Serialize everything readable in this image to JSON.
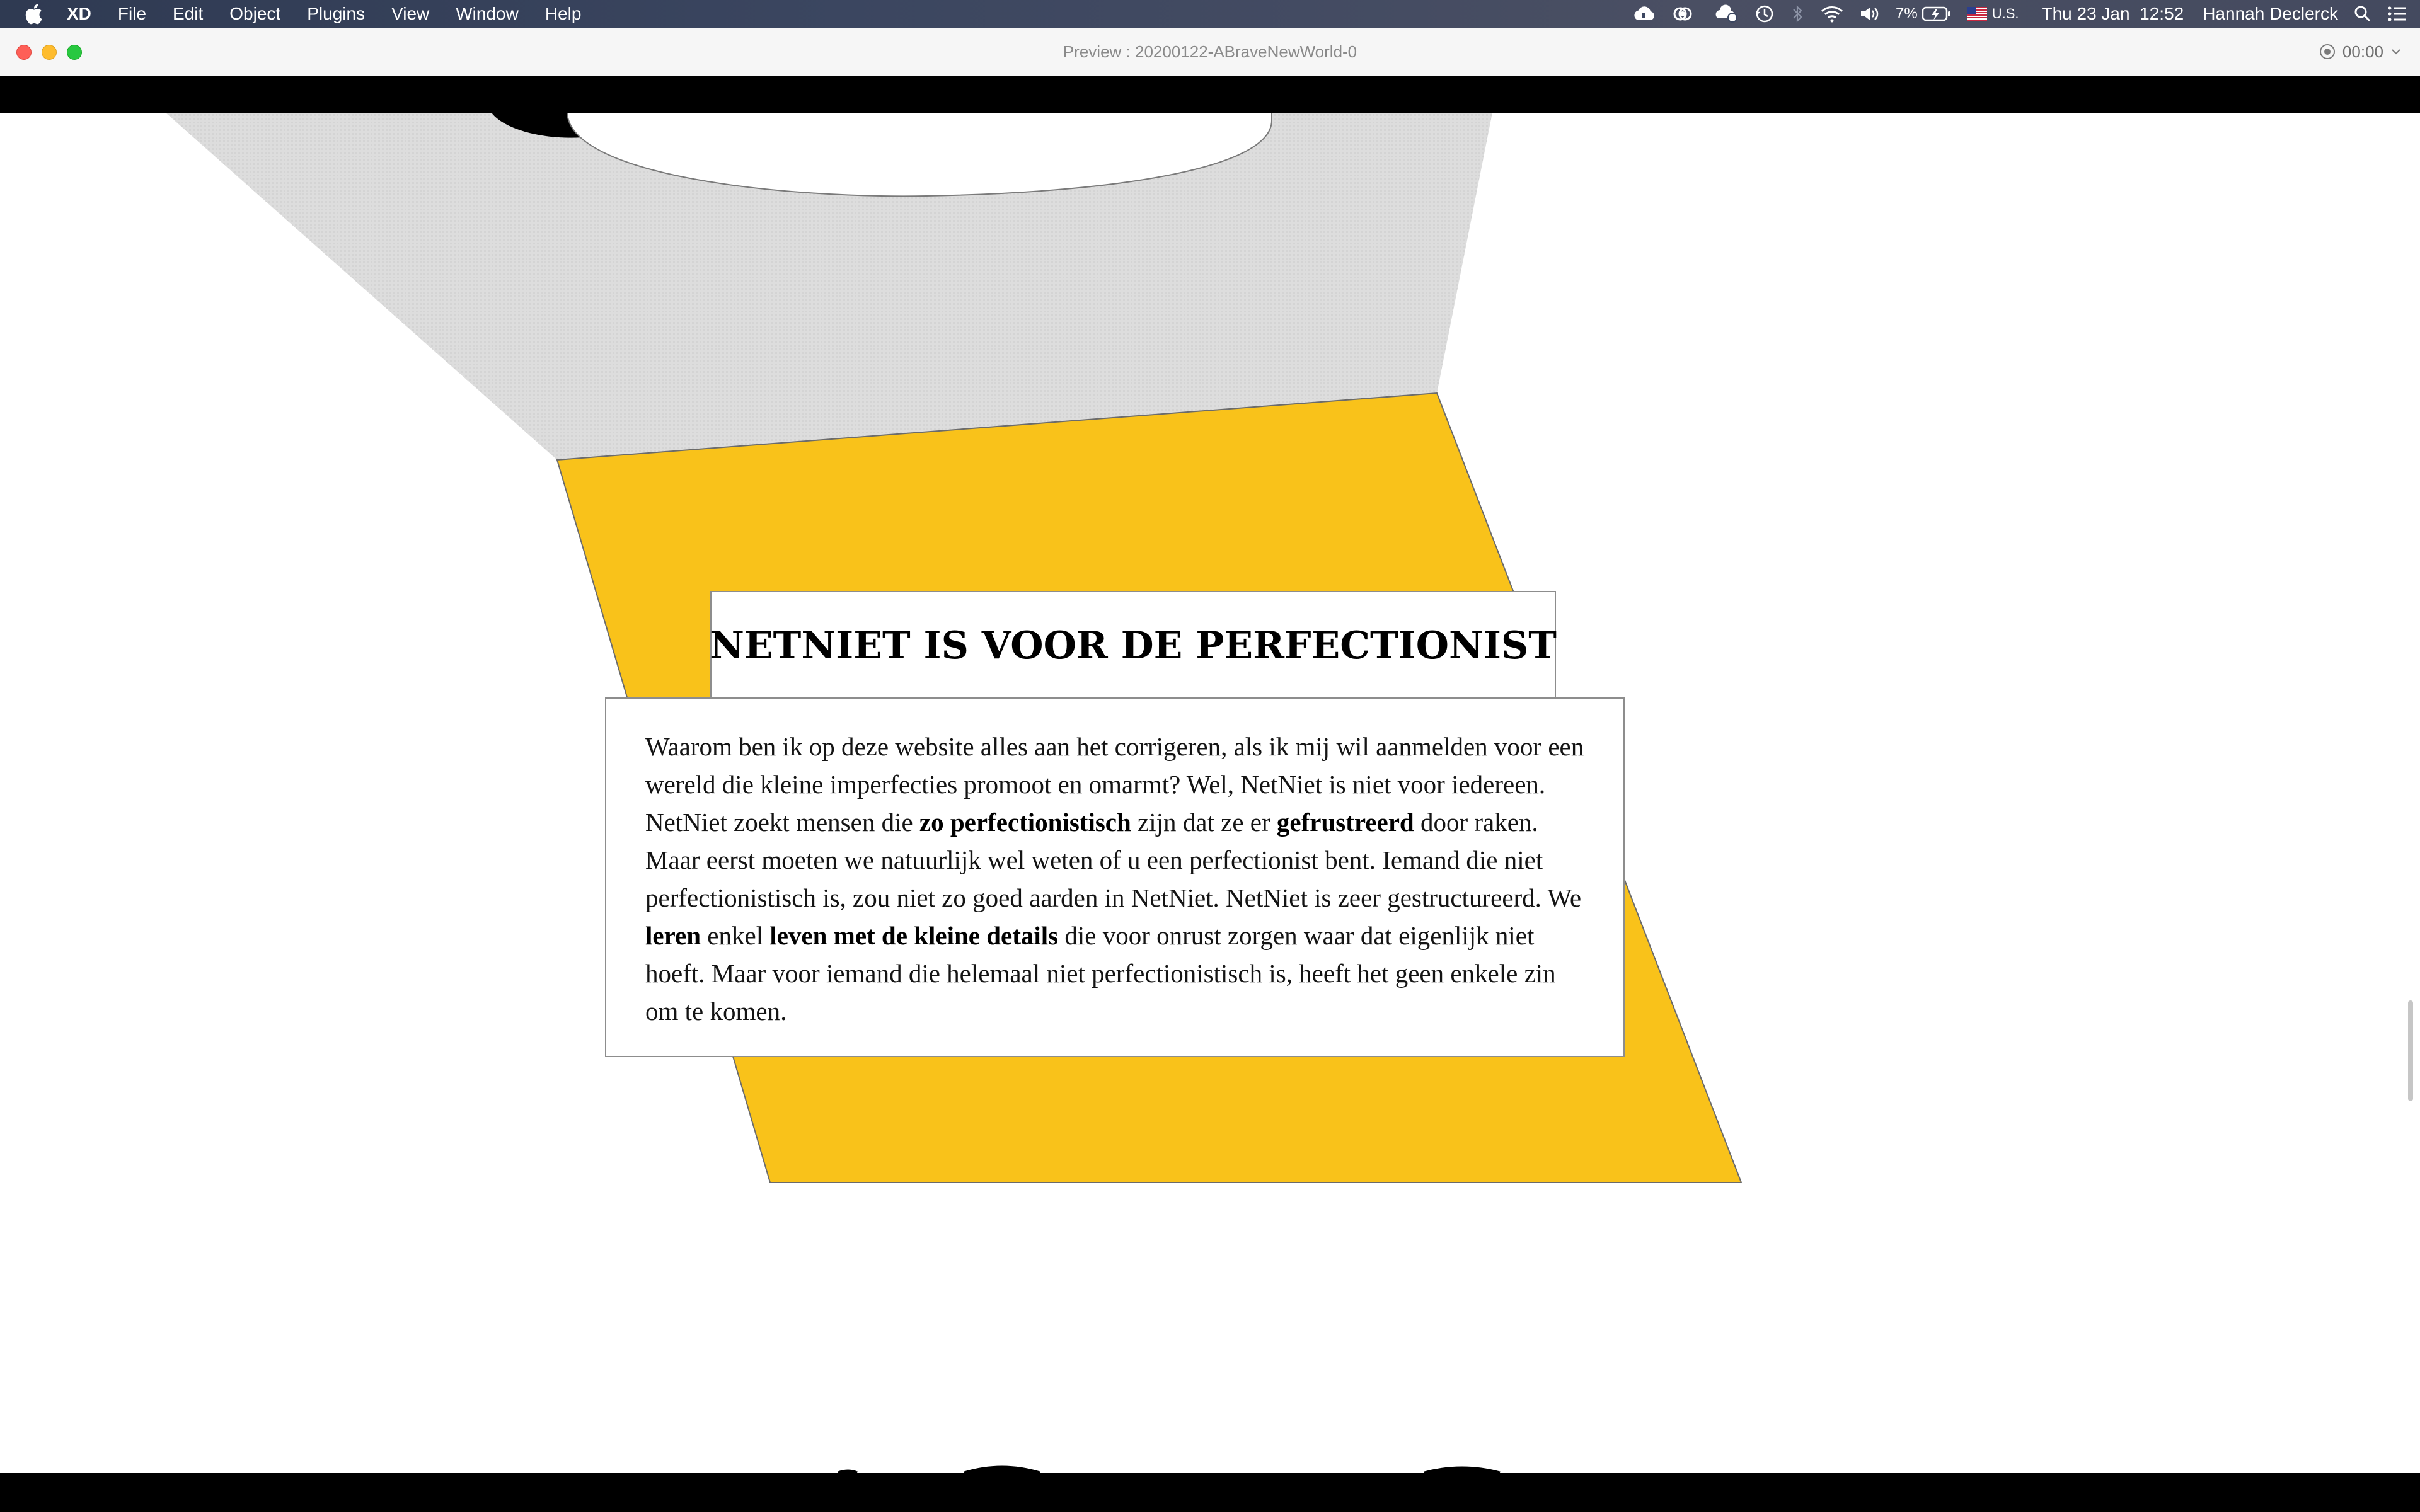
{
  "menubar": {
    "app_name": "XD",
    "menus": [
      "File",
      "Edit",
      "Object",
      "Plugins",
      "View",
      "Window",
      "Help"
    ],
    "battery": "7%",
    "input_source": "U.S.",
    "datetime": "Thu 23 Jan  12:52",
    "user": "Hannah Declerck",
    "icons": [
      "apple-logo",
      "creative-cloud",
      "cc-files",
      "cloud-sync",
      "time-machine",
      "bluetooth",
      "wifi",
      "volume",
      "battery-charging",
      "us-flag",
      "spotlight-search",
      "notification-center"
    ]
  },
  "window": {
    "title": "Preview : 20200122-ABraveNewWorld-0",
    "record_time": "00:00"
  },
  "content": {
    "heading": "NETNIET IS VOOR DE PERFECTIONIST",
    "paragraph": {
      "p1": "Waarom ben ik op deze website alles aan het corrigeren, als ik mij wil aanmelden voor een wereld die kleine imperfecties promoot en omarmt? Wel, NetNiet is niet voor iedereen. NetNiet zoekt mensen die ",
      "b1": "zo perfectionistisch",
      "p2": " zijn dat ze er ",
      "b2": "gefrustreerd",
      "p3": " door raken. Maar eerst moeten we natuurlijk wel weten of u een perfectionist bent. Iemand die niet perfectionistisch is, zou niet zo goed aarden in NetNiet. NetNiet is zeer gestructureerd. We ",
      "b3": "leren",
      "p4": " enkel ",
      "b4": "leven met de kleine details",
      "p5": " die voor onrust zorgen waar dat eigenlijk niet hoeft. Maar voor iemand die helemaal niet perfectionistisch is, heeft het geen enkele zin om te komen."
    }
  },
  "colors": {
    "accent_yellow": "#f9c21a",
    "gray_shape": "#dcdcdc",
    "black_band": "#000000"
  }
}
